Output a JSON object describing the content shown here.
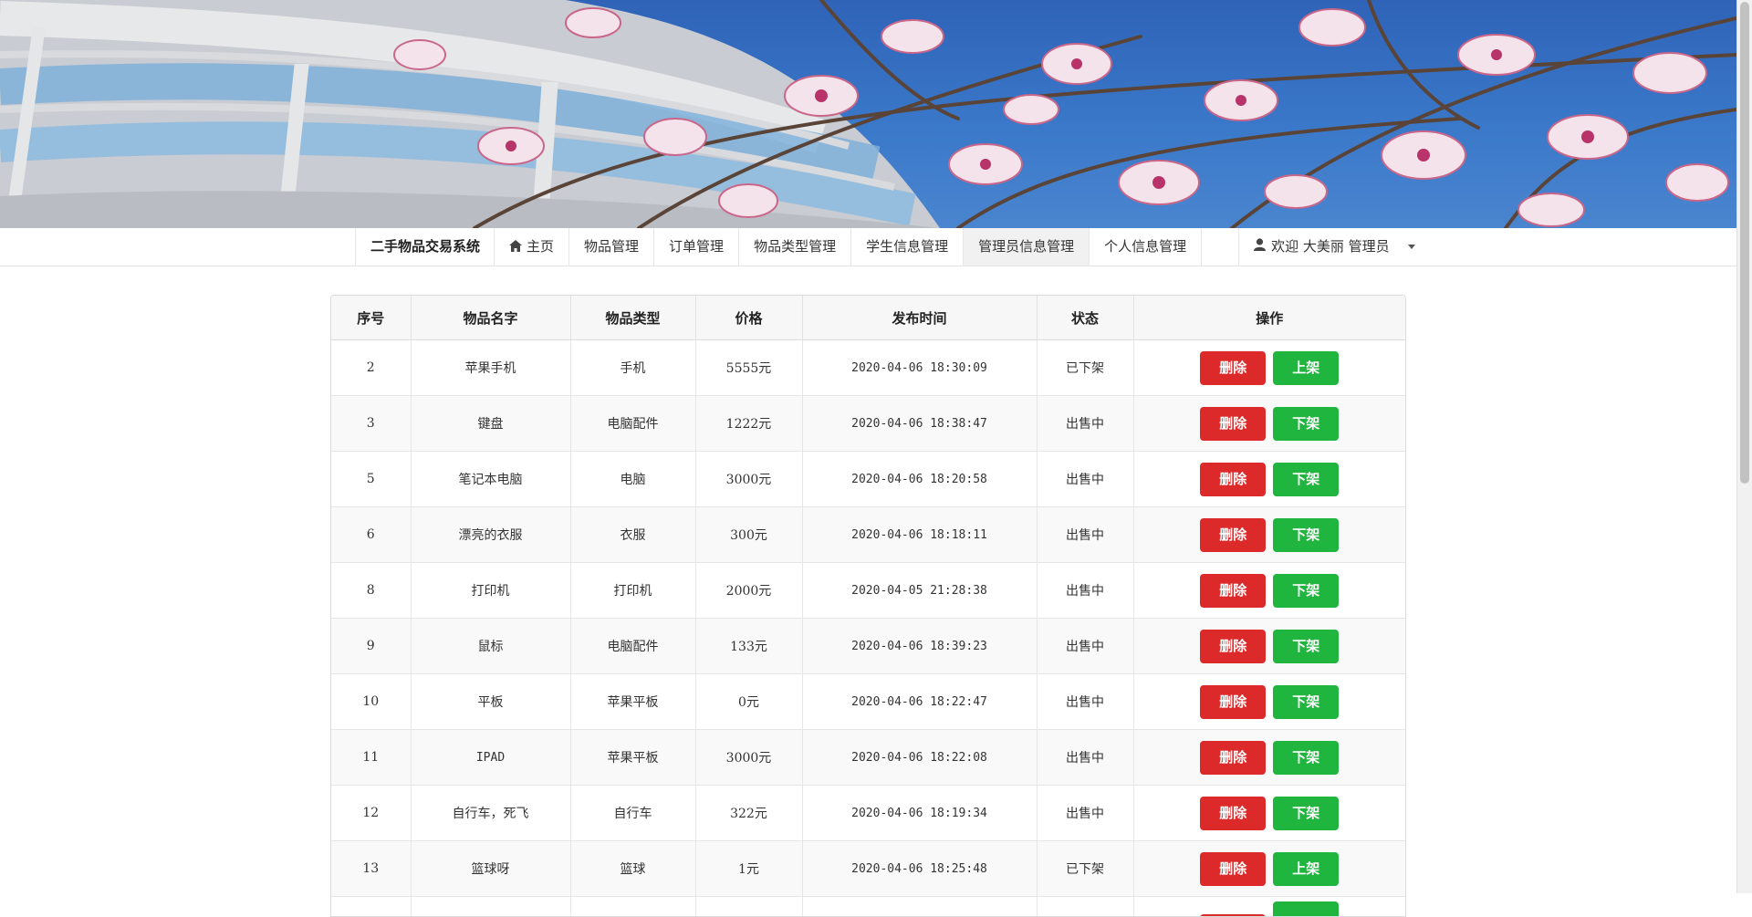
{
  "nav": {
    "brand": "二手物品交易系统",
    "home": "主页",
    "items": [
      "物品管理",
      "订单管理",
      "物品类型管理",
      "学生信息管理",
      "管理员信息管理",
      "个人信息管理"
    ],
    "user_label": "欢迎 大美丽 管理员"
  },
  "table": {
    "headers": [
      "序号",
      "物品名字",
      "物品类型",
      "价格",
      "发布时间",
      "状态",
      "操作"
    ],
    "delete_label": "删除",
    "rows": [
      {
        "id": "2",
        "name": "苹果手机",
        "type": "手机",
        "price": "5555元",
        "time": "2020-04-06 18:30:09",
        "status": "已下架",
        "action": "上架"
      },
      {
        "id": "3",
        "name": "键盘",
        "type": "电脑配件",
        "price": "1222元",
        "time": "2020-04-06 18:38:47",
        "status": "出售中",
        "action": "下架"
      },
      {
        "id": "5",
        "name": "笔记本电脑",
        "type": "电脑",
        "price": "3000元",
        "time": "2020-04-06 18:20:58",
        "status": "出售中",
        "action": "下架"
      },
      {
        "id": "6",
        "name": "漂亮的衣服",
        "type": "衣服",
        "price": "300元",
        "time": "2020-04-06 18:18:11",
        "status": "出售中",
        "action": "下架"
      },
      {
        "id": "8",
        "name": "打印机",
        "type": "打印机",
        "price": "2000元",
        "time": "2020-04-05 21:28:38",
        "status": "出售中",
        "action": "下架"
      },
      {
        "id": "9",
        "name": "鼠标",
        "type": "电脑配件",
        "price": "133元",
        "time": "2020-04-06 18:39:23",
        "status": "出售中",
        "action": "下架"
      },
      {
        "id": "10",
        "name": "平板",
        "type": "苹果平板",
        "price": "0元",
        "time": "2020-04-06 18:22:47",
        "status": "出售中",
        "action": "下架"
      },
      {
        "id": "11",
        "name": "IPAD",
        "type": "苹果平板",
        "price": "3000元",
        "time": "2020-04-06 18:22:08",
        "status": "出售中",
        "action": "下架"
      },
      {
        "id": "12",
        "name": "自行车，死飞",
        "type": "自行车",
        "price": "322元",
        "time": "2020-04-06 18:19:34",
        "status": "出售中",
        "action": "下架"
      },
      {
        "id": "13",
        "name": "篮球呀",
        "type": "篮球",
        "price": "1元",
        "time": "2020-04-06 18:25:48",
        "status": "已下架",
        "action": "上架"
      },
      {
        "id": "",
        "name": "",
        "type": "",
        "price": "",
        "time": "",
        "status": "",
        "action": ""
      }
    ]
  },
  "colors": {
    "delete": "#dc2a2a",
    "toggle": "#1fb53f",
    "sky": "#2f63b8"
  },
  "icons": {
    "home": "home-icon",
    "user": "user-icon",
    "caret": "caret-down-icon"
  }
}
